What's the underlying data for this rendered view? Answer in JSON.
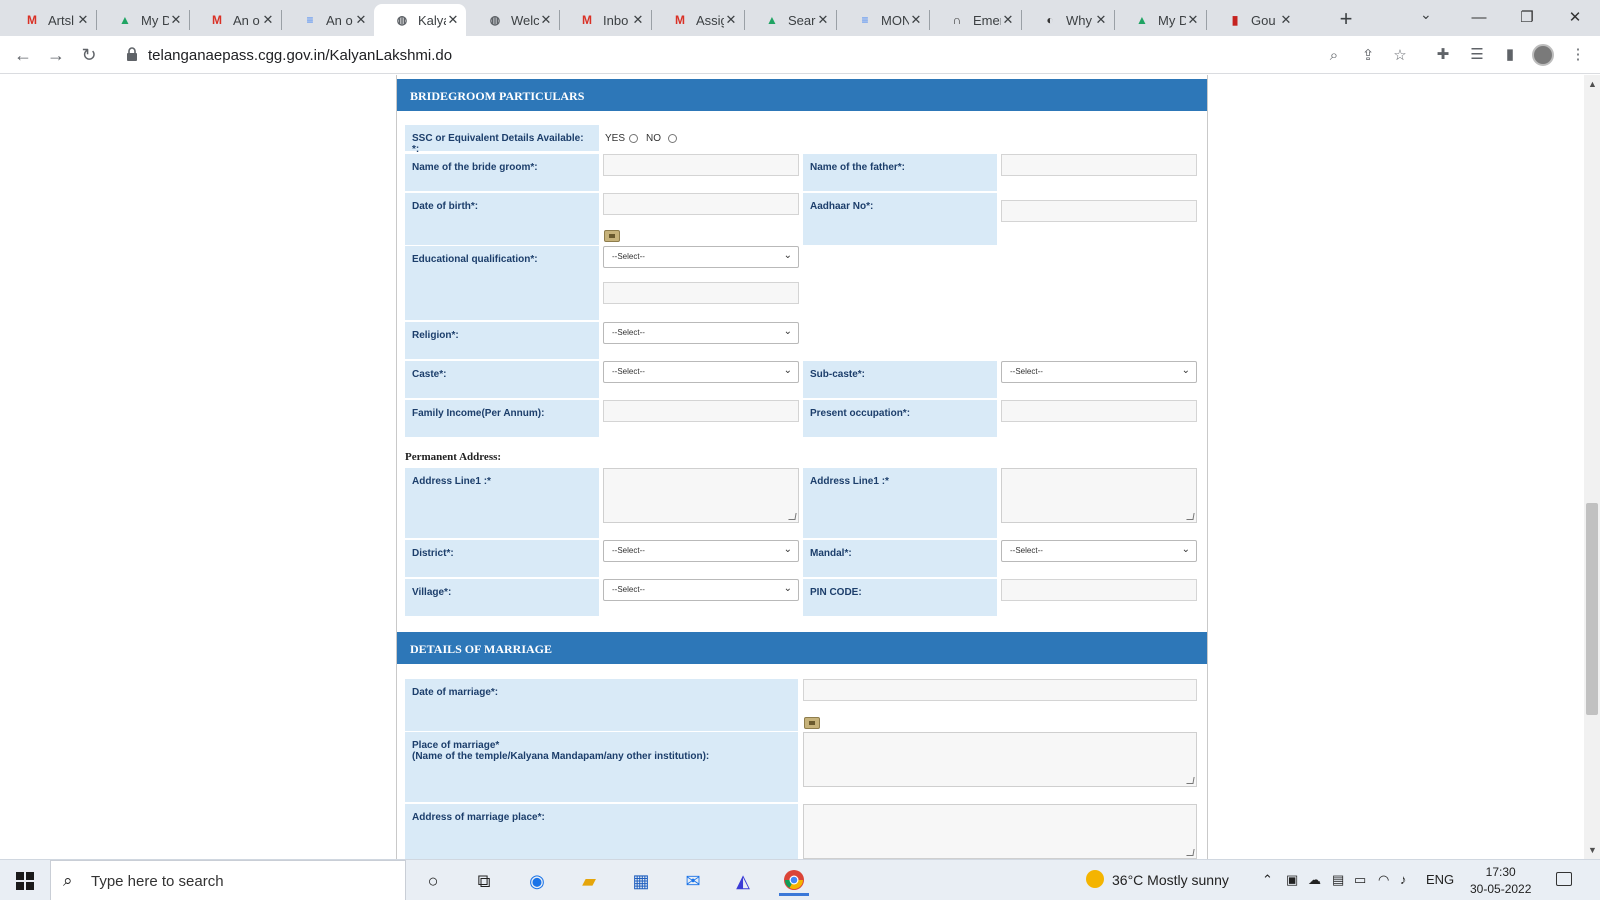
{
  "browser": {
    "tabs": [
      {
        "label": "Artsl",
        "icon": "gmail-icon",
        "icon_char": "M",
        "icon_color": "#d93025"
      },
      {
        "label": "My D",
        "icon": "google-drive-icon",
        "icon_char": "▲",
        "icon_color": "#1fa463"
      },
      {
        "label": "An o",
        "icon": "gmail-icon",
        "icon_char": "M",
        "icon_color": "#d93025"
      },
      {
        "label": "An o",
        "icon": "google-docs-icon",
        "icon_char": "≡",
        "icon_color": "#4285f4"
      },
      {
        "label": "Kalya",
        "icon": "globe-icon",
        "icon_char": "◍",
        "icon_color": "#5f6368"
      },
      {
        "label": "Welc",
        "icon": "globe-icon",
        "icon_char": "◍",
        "icon_color": "#5f6368"
      },
      {
        "label": "Inbo",
        "icon": "gmail-icon",
        "icon_char": "M",
        "icon_color": "#d93025"
      },
      {
        "label": "Assig",
        "icon": "gmail-icon",
        "icon_char": "M",
        "icon_color": "#d93025"
      },
      {
        "label": "Sear",
        "icon": "google-drive-icon",
        "icon_char": "▲",
        "icon_color": "#1fa463"
      },
      {
        "label": "MON",
        "icon": "google-docs-icon",
        "icon_char": "≡",
        "icon_color": "#4285f4"
      },
      {
        "label": "Emer",
        "icon": "headset-icon",
        "icon_char": "∩",
        "icon_color": "#333333"
      },
      {
        "label": "Why",
        "icon": "edge-like-icon",
        "icon_char": "◐",
        "icon_color": "#333333"
      },
      {
        "label": "My D",
        "icon": "google-drive-icon",
        "icon_char": "▲",
        "icon_color": "#1fa463"
      },
      {
        "label": "Gou",
        "icon": "book-icon",
        "icon_char": "▮",
        "icon_color": "#c5221f"
      }
    ],
    "active_tab": 4,
    "close_glyph": "✕",
    "url": "telanganaepass.cgg.gov.in/KalyanLakshmi.do"
  },
  "form": {
    "bridegroom_header": "BRIDEGROOM PARTICULARS",
    "ssc_label": "SSC or Equivalent Details Available: *:",
    "ssc_yes": "YES",
    "ssc_no": "NO",
    "groom_name_label": "Name of the bride groom*:",
    "father_name_label": "Name of the father*:",
    "dob_label": "Date of birth*:",
    "aadhaar_label": "Aadhaar No*:",
    "education_label": "Educational qualification*:",
    "religion_label": "Religion*:",
    "caste_label": "Caste*:",
    "subcaste_label": "Sub-caste*:",
    "income_label": "Family Income(Per Annum):",
    "occupation_label": "Present occupation*:",
    "permanent_address": "Permanent Address:",
    "address_line1_left": "Address Line1 :*",
    "address_line1_right": "Address Line1 :*",
    "district_label": "District*:",
    "mandal_label": "Mandal*:",
    "village_label": "Village*:",
    "pincode_label": "PIN CODE:",
    "select_placeholder": "--Select--",
    "marriage_header": "DETAILS OF MARRIAGE",
    "marriage_date_label": "Date of marriage*:",
    "marriage_place_label": "Place of marriage*",
    "marriage_place_sub": "(Name of the temple/Kalyana Mandapam/any other institution):",
    "marriage_address_label": "Address of marriage place*:"
  },
  "taskbar": {
    "search_placeholder": "Type here to search",
    "weather": "36°C  Mostly sunny",
    "language": "ENG",
    "time": "17:30",
    "date": "30-05-2022"
  }
}
